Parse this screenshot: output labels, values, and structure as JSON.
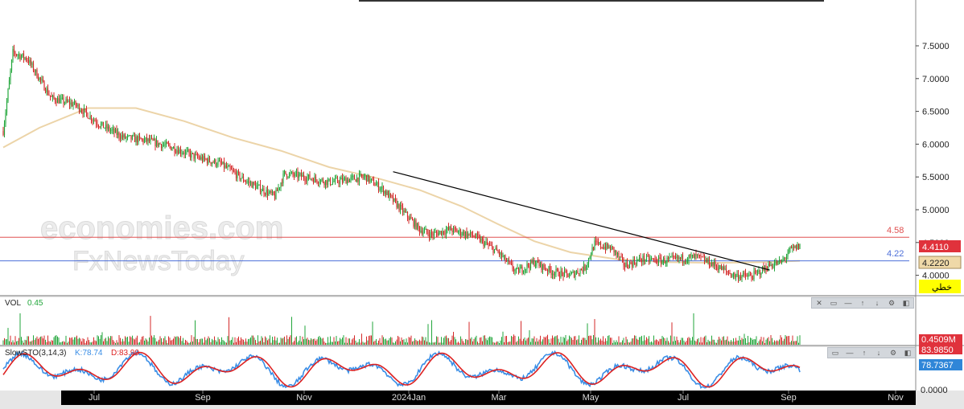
{
  "watermark": {
    "line1": "economies.com",
    "line2": "FxNewsToday"
  },
  "price_axis": {
    "ticks": [
      "7.5000",
      "7.0000",
      "6.5000",
      "6.0000",
      "5.5000",
      "5.0000",
      "4.5000",
      "4.0000"
    ]
  },
  "levels": [
    {
      "label": "4.58",
      "value": 4.58,
      "color": "#e05050"
    },
    {
      "label": "4.22",
      "value": 4.22,
      "color": "#4d6fd9"
    }
  ],
  "tags": {
    "last_price": "4.4110",
    "ma_value": "4.2220",
    "linear_button": "خطي"
  },
  "volume_panel": {
    "title": "VOL",
    "value": "0.45",
    "tag_top": "0.4509M",
    "tag_bottom": "83.9850"
  },
  "sto_panel": {
    "title": "SlowSTO(3,14,3)",
    "k_label": "K:78.74",
    "d_label": "D:83.99",
    "tag": "78.7367",
    "zero": "0.0000"
  },
  "time_axis": {
    "labels": [
      "Jul",
      "Sep",
      "Nov",
      "2024Jan",
      "Mar",
      "May",
      "Jul",
      "Sep",
      "Nov"
    ]
  },
  "toolbar_icons": [
    "close-icon",
    "restore-icon",
    "minimize-icon",
    "move-up-icon",
    "move-down-icon",
    "settings-icon",
    "scroll-icon"
  ],
  "colors": {
    "up": "#22a63b",
    "down": "#d42a2a",
    "ma": "#ecd4a8",
    "trend": "#000000",
    "k_line": "#3a8ee6",
    "d_line": "#dd2222"
  },
  "chart_data": [
    {
      "type": "candlestick",
      "title": "",
      "ylim": [
        3.8,
        7.85
      ],
      "x_labels": [
        "Jul",
        "Sep",
        "Nov",
        "2024Jan",
        "Mar",
        "May",
        "Jul",
        "Sep",
        "Nov"
      ],
      "price_anchors": [
        [
          0,
          6.2
        ],
        [
          8,
          7.4
        ],
        [
          20,
          7.3
        ],
        [
          40,
          6.7
        ],
        [
          60,
          6.6
        ],
        [
          80,
          6.3
        ],
        [
          100,
          6.1
        ],
        [
          120,
          6.05
        ],
        [
          140,
          5.95
        ],
        [
          160,
          5.8
        ],
        [
          180,
          5.7
        ],
        [
          200,
          5.45
        ],
        [
          215,
          5.3
        ],
        [
          225,
          5.2
        ],
        [
          233,
          5.55
        ],
        [
          250,
          5.5
        ],
        [
          270,
          5.42
        ],
        [
          282,
          5.45
        ],
        [
          300,
          5.5
        ],
        [
          315,
          5.3
        ],
        [
          330,
          5.0
        ],
        [
          345,
          4.7
        ],
        [
          355,
          4.62
        ],
        [
          370,
          4.7
        ],
        [
          390,
          4.6
        ],
        [
          410,
          4.35
        ],
        [
          425,
          4.05
        ],
        [
          440,
          4.2
        ],
        [
          455,
          4.05
        ],
        [
          470,
          4.0
        ],
        [
          482,
          4.12
        ],
        [
          490,
          4.48
        ],
        [
          505,
          4.4
        ],
        [
          515,
          4.15
        ],
        [
          530,
          4.25
        ],
        [
          545,
          4.22
        ],
        [
          560,
          4.25
        ],
        [
          575,
          4.28
        ],
        [
          590,
          4.15
        ],
        [
          605,
          4.0
        ],
        [
          620,
          3.98
        ],
        [
          635,
          4.15
        ],
        [
          645,
          4.2
        ],
        [
          652,
          4.38
        ],
        [
          660,
          4.45
        ]
      ],
      "moving_average": [
        [
          0,
          5.95
        ],
        [
          30,
          6.25
        ],
        [
          70,
          6.55
        ],
        [
          110,
          6.55
        ],
        [
          150,
          6.35
        ],
        [
          190,
          6.1
        ],
        [
          230,
          5.9
        ],
        [
          270,
          5.65
        ],
        [
          310,
          5.48
        ],
        [
          345,
          5.3
        ],
        [
          380,
          5.05
        ],
        [
          410,
          4.78
        ],
        [
          440,
          4.52
        ],
        [
          470,
          4.35
        ],
        [
          510,
          4.24
        ],
        [
          550,
          4.2
        ],
        [
          590,
          4.19
        ],
        [
          630,
          4.2
        ],
        [
          660,
          4.22
        ]
      ],
      "trendline": {
        "from": [
          323,
          5.58
        ],
        "to": [
          635,
          4.08
        ]
      },
      "levels": [
        4.58,
        4.22
      ],
      "last_price": 4.411
    },
    {
      "type": "bar",
      "title": "VOL",
      "last_value": 0.45,
      "tag": "0.4509M"
    },
    {
      "type": "line",
      "title": "SlowSTO(3,14,3)",
      "series": [
        {
          "name": "K",
          "last": 78.74
        },
        {
          "name": "D",
          "last": 83.99
        }
      ],
      "ylim": [
        0,
        100
      ]
    }
  ]
}
